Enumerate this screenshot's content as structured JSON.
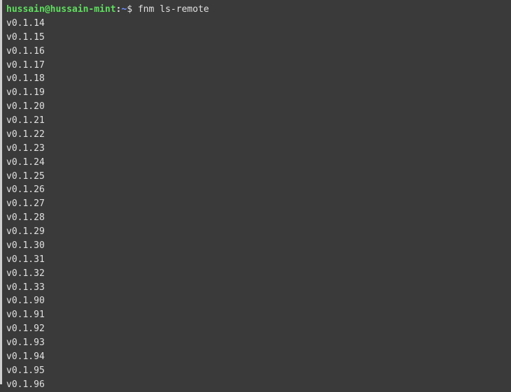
{
  "prompt": {
    "user_host": "hussain@hussain-mint",
    "colon": ":",
    "path": "~",
    "dollar": "$ ",
    "command": "fnm ls-remote"
  },
  "output": [
    "v0.1.14",
    "v0.1.15",
    "v0.1.16",
    "v0.1.17",
    "v0.1.18",
    "v0.1.19",
    "v0.1.20",
    "v0.1.21",
    "v0.1.22",
    "v0.1.23",
    "v0.1.24",
    "v0.1.25",
    "v0.1.26",
    "v0.1.27",
    "v0.1.28",
    "v0.1.29",
    "v0.1.30",
    "v0.1.31",
    "v0.1.32",
    "v0.1.33",
    "v0.1.90",
    "v0.1.91",
    "v0.1.92",
    "v0.1.93",
    "v0.1.94",
    "v0.1.95",
    "v0.1.96"
  ]
}
